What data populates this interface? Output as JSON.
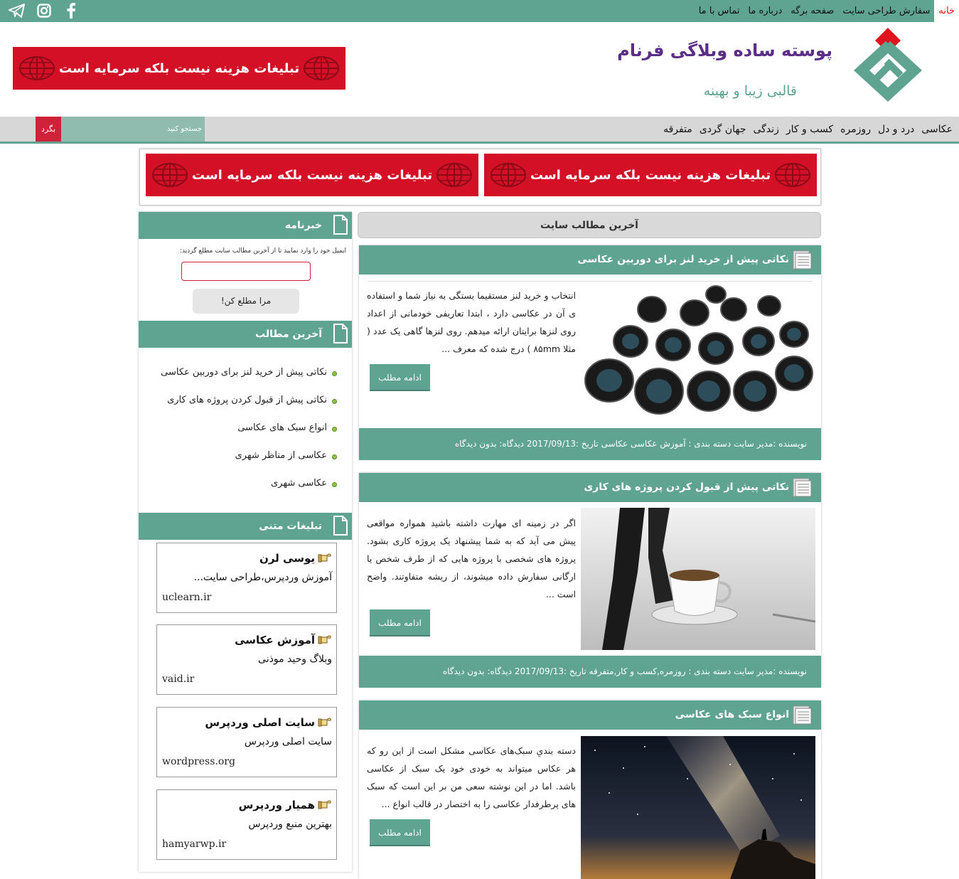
{
  "topbar": {
    "menu": [
      "خانه",
      "سفارش طراحی سایت",
      "صفحه برگه",
      "درباره ما",
      "تماس با ما"
    ],
    "social": [
      "facebook-icon",
      "instagram-icon",
      "telegram-icon"
    ]
  },
  "header": {
    "title": "پوسته ساده وبلاگی فرنام",
    "subtitle": "قالبی زیبا و بهینه",
    "ad_text": "تبلیغات هزینه نیست بلکه سرمایه است"
  },
  "nav": {
    "items": [
      "عکاسی",
      "درد و دل",
      "روزمره",
      "کسب و کار",
      "زندگی",
      "جهان گردی",
      "متفرقه"
    ],
    "search_placeholder": "جستجو کنید",
    "search_button": "بگرد"
  },
  "ads": [
    "تبلیغات هزینه نیست بلکه سرمایه است",
    "تبلیغات هزینه نیست بلکه سرمایه است"
  ],
  "sidebar": {
    "newsletter": {
      "title": "خبرنامه",
      "text": "ایمیل خود را وارد نمایید تا از آخرین مطالب سایت مطلع گردید:",
      "button": "مرا مطلع کن!"
    },
    "latest": {
      "title": "آخرین مطالب",
      "items": [
        "نکاتی پیش از خرید لنز برای دوربین عکاسی",
        "نکاتی پیش از قبول کردن پروژه های کاری",
        "انواع سبک های عکاسی",
        "عکاسی از مناظر شهری",
        "عکاسی شهری"
      ]
    },
    "text_ads": {
      "title": "تبلیغات متنی",
      "items": [
        {
          "title": "یوسی لرن",
          "desc": "آموزش وردپرس،طراحی سایت...",
          "url": "uclearn.ir"
        },
        {
          "title": "آموزش عکاسی",
          "desc": "وبلاگ وحید موذنی",
          "url": "vaid.ir"
        },
        {
          "title": "سایت اصلی وردپرس",
          "desc": "سایت اصلی وردپرس",
          "url": "wordpress.org"
        },
        {
          "title": "همیار وردپرس",
          "desc": "بهترین منبع وردپرس",
          "url": "hamyarwp.ir"
        }
      ]
    }
  },
  "main": {
    "latest_label": "آخرین مطالب سایت",
    "more_label": "ادامه مطلب",
    "posts": [
      {
        "title": "نکاتی پیش از خرید لنز برای دوربین عکاسی",
        "excerpt": "انتخاب و خرید لنز مستقیما بستگی به نیاز شما و استفاده ی آن در عکاسی دارد ، ابتدا تعاریفی خودمانی از اعداد روی لنزها برایتان ارائه میدهم. روی لنزها گاهی یک عدد ( مثلا ۸۵mm ) درج شده که معرف ...",
        "meta": "نویسنده :مدیر سایت   دسته بندی : آموزش عکاسی عکاسی   تاریخ :2017/09/13   دیدگاه: بدون دیدگاه"
      },
      {
        "title": "نکاتی پیش از قبول کردن پروژه های کاری",
        "excerpt": "اگر در زمینه ای مهارت داشته باشید همواره مواقعی پیش می آید که به شما پیشنهاد یک پروژه کاری بشود. پروژه های شخصی با پروژه هایی که از طرف شخص یا ارگانی سفارش داده میشوند، از ریشه متفاوتند. واضح است ...",
        "meta": "نویسنده :مدیر سایت   دسته بندی : روزمره,کسب و کار,متفرقه   تاریخ :2017/09/13   دیدگاه: بدون دیدگاه"
      },
      {
        "title": "انواع سبک های عکاسی",
        "excerpt": "دسته بندیِ سبک‌های عکاسی مشکل است از این رو که هر عکاس میتواند به خودی خود یک سبک از عکاسی باشد. اما در این نوشته سعی من بر این است که سبک های پرطرفدار عکاسی را به اختصار در قالب انواع ...",
        "meta": ""
      }
    ]
  },
  "colors": {
    "brand_green": "#5fa391",
    "ad_red": "#d41027",
    "title_purple": "#5b2d86",
    "accent_red": "#e0141e"
  }
}
